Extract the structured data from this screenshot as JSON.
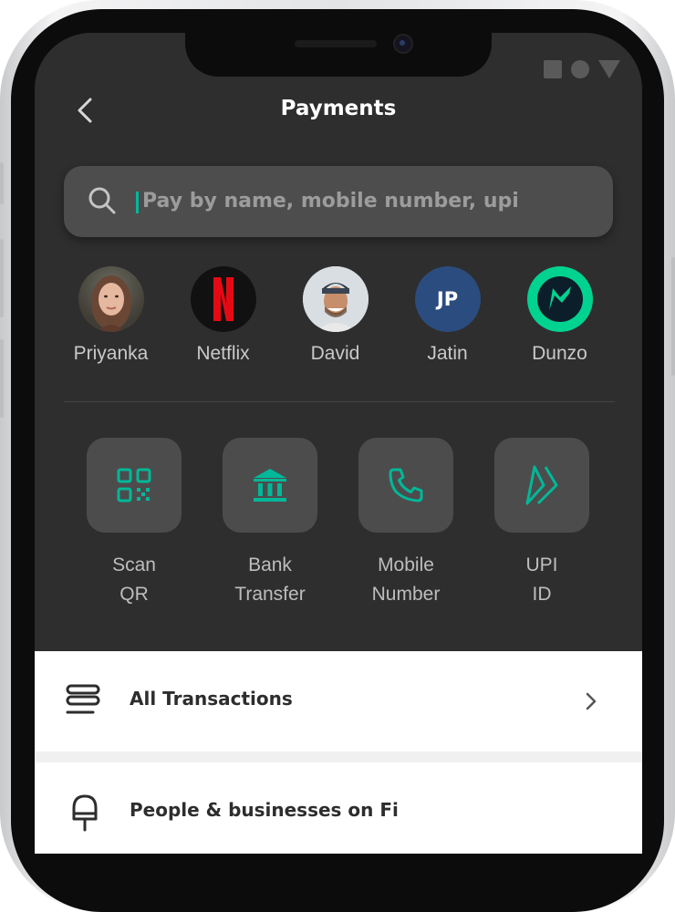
{
  "header": {
    "title": "Payments"
  },
  "search": {
    "placeholder": "Pay by name, mobile number, upi"
  },
  "contacts": [
    {
      "name": "Priyanka",
      "initials": ""
    },
    {
      "name": "Netflix",
      "initials": ""
    },
    {
      "name": "David",
      "initials": ""
    },
    {
      "name": "Jatin",
      "initials": "JP"
    },
    {
      "name": "Dunzo",
      "initials": ""
    }
  ],
  "actions": [
    {
      "line1": "Scan",
      "line2": "QR",
      "icon": "qr-code-icon"
    },
    {
      "line1": "Bank",
      "line2": "Transfer",
      "icon": "bank-icon"
    },
    {
      "line1": "Mobile",
      "line2": "Number",
      "icon": "phone-icon"
    },
    {
      "line1": "UPI",
      "line2": "ID",
      "icon": "upi-icon"
    }
  ],
  "list": {
    "all_transactions": "All Transactions",
    "people_businesses": "People & businesses on Fi"
  },
  "colors": {
    "accent": "#00b899",
    "background": "#2e2e2e",
    "tile": "#4c4c4c",
    "jatin_avatar": "#2b4c7e",
    "dunzo_avatar": "#00d290"
  }
}
